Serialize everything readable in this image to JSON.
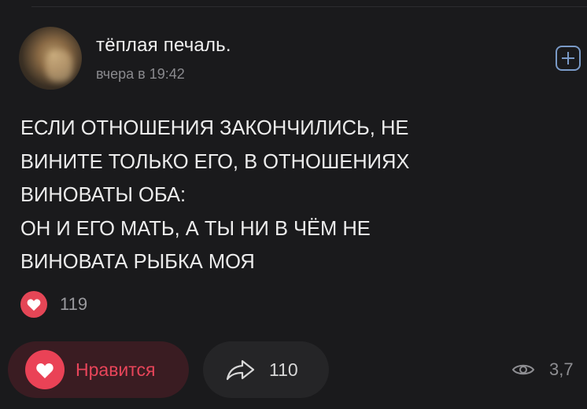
{
  "post": {
    "author": "тёплая печаль.",
    "time": "вчера в 19:42",
    "text": "ЕСЛИ ОТНОШЕНИЯ ЗАКОНЧИЛИСЬ, НЕ\nВИНИТЕ ТОЛЬКО ЕГО, В ОТНОШЕНИЯХ\nВИНОВАТЫ ОБА:\nОН И ЕГО МАТЬ, А ТЫ НИ В ЧЁМ НЕ\nВИНОВАТА РЫБКА МОЯ",
    "likes_count": "119"
  },
  "actions": {
    "like_label": "Нравится",
    "share_count": "110",
    "views": "3,7"
  },
  "icons": {
    "add": "plus-square-icon",
    "like": "heart-icon",
    "share": "share-arrow-icon",
    "views": "eye-icon"
  },
  "colors": {
    "background": "#1a1a1c",
    "accent_red": "#e8455a",
    "accent_blue": "#7a9ac7"
  }
}
